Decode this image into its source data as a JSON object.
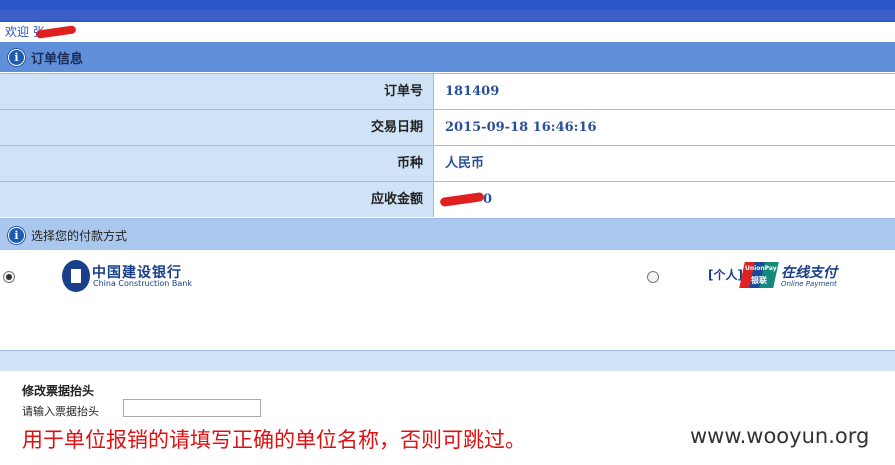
{
  "header": {
    "welcome_text": "欢迎 张"
  },
  "order_section": {
    "title": "订单信息",
    "rows": [
      {
        "label": "订单号",
        "value": "181409"
      },
      {
        "label": "交易日期",
        "value": "2015-09-18 16:46:16"
      },
      {
        "label": "币种",
        "value": "人民币"
      },
      {
        "label": "应收金额",
        "value": "0"
      }
    ]
  },
  "payment_section": {
    "title": "选择您的付款方式",
    "options": [
      {
        "name_cn": "中国建设银行",
        "name_en": "China Construction Bank",
        "selected": true
      },
      {
        "prefix": "[个人]",
        "badge_en": "UnionPay",
        "badge_cn": "银联",
        "name_cn": "在线支付",
        "name_en": "Online Payment",
        "selected": false
      }
    ]
  },
  "invoice": {
    "title": "修改票据抬头",
    "label": "请输入票据抬头",
    "input_value": ""
  },
  "annotation": "用于单位报销的请填写正确的单位名称，否则可跳过。",
  "watermark": "www.wooyun.org",
  "colors": {
    "header_blue": "#2a55c8",
    "section_blue": "#5f8fd8",
    "label_bg": "#cfe2f6",
    "value_text": "#2a4f9a",
    "annotation_red": "#e01010"
  }
}
